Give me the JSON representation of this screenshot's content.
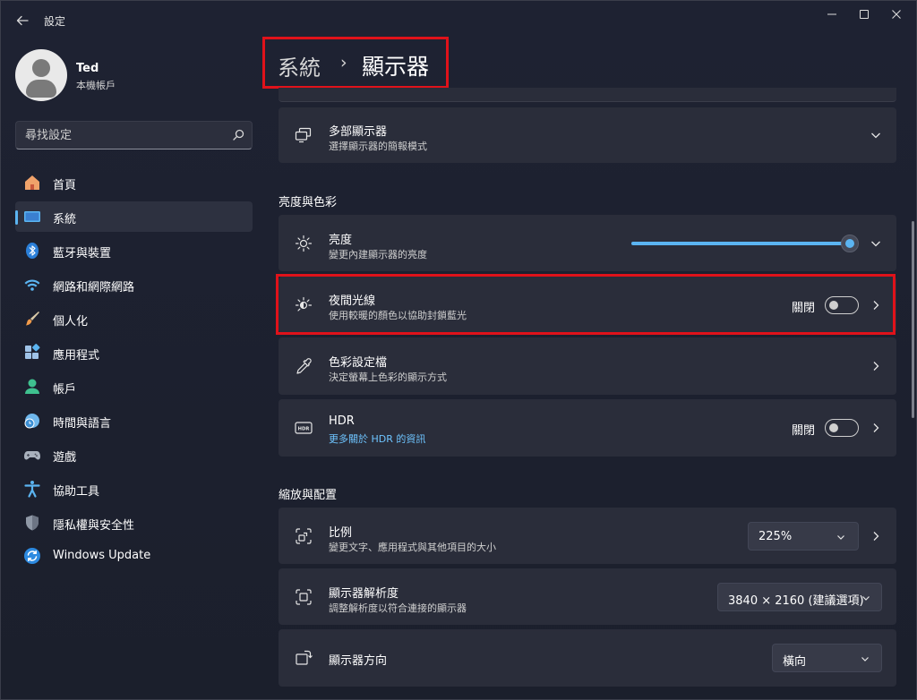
{
  "window": {
    "title": "設定"
  },
  "user": {
    "name": "Ted",
    "account_type": "本機帳戶"
  },
  "search": {
    "placeholder": "尋找設定"
  },
  "nav": {
    "items": [
      {
        "label": "首頁",
        "icon": "home-icon"
      },
      {
        "label": "系統",
        "icon": "system-display-icon",
        "selected": true
      },
      {
        "label": "藍牙與裝置",
        "icon": "bluetooth-icon"
      },
      {
        "label": "網路和網際網路",
        "icon": "wifi-icon"
      },
      {
        "label": "個人化",
        "icon": "paintbrush-icon"
      },
      {
        "label": "應用程式",
        "icon": "apps-icon"
      },
      {
        "label": "帳戶",
        "icon": "account-icon"
      },
      {
        "label": "時間與語言",
        "icon": "time-language-icon"
      },
      {
        "label": "遊戲",
        "icon": "gamepad-icon"
      },
      {
        "label": "協助工具",
        "icon": "accessibility-icon"
      },
      {
        "label": "隱私權與安全性",
        "icon": "shield-icon"
      },
      {
        "label": "Windows Update",
        "icon": "windows-update-icon"
      }
    ]
  },
  "breadcrumb": {
    "parent": "系統",
    "separator": "›",
    "current": "顯示器"
  },
  "multi_display": {
    "title": "多部顯示器",
    "subtitle": "選擇顯示器的簡報模式"
  },
  "brightness_color": {
    "header": "亮度與色彩",
    "brightness": {
      "title": "亮度",
      "subtitle": "變更內建顯示器的亮度",
      "level": 1.0
    },
    "night_light": {
      "title": "夜間光線",
      "subtitle": "使用較暖的顏色以協助封鎖藍光",
      "state": "關閉"
    },
    "color_profile": {
      "title": "色彩設定檔",
      "subtitle": "決定螢幕上色彩的顯示方式"
    },
    "hdr": {
      "title": "HDR",
      "link": "更多關於 HDR 的資訊",
      "state": "關閉"
    }
  },
  "scale_layout": {
    "header": "縮放與配置",
    "scale": {
      "title": "比例",
      "subtitle": "變更文字、應用程式與其他項目的大小",
      "value": "225%"
    },
    "resolution": {
      "title": "顯示器解析度",
      "subtitle": "調整解析度以符合連接的顯示器",
      "value": "3840 × 2160 (建議選項)"
    },
    "orientation": {
      "title": "顯示器方向",
      "value": "橫向"
    }
  },
  "colors": {
    "accent": "#5bb4f1",
    "highlight": "#e0121a",
    "card": "#2a2d3a"
  }
}
